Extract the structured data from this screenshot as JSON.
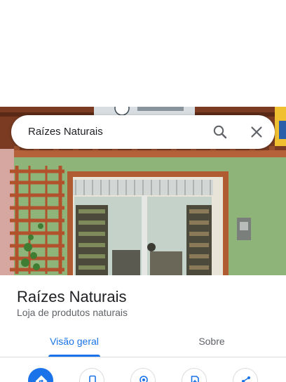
{
  "search": {
    "query": "Raízes Naturais"
  },
  "place": {
    "name": "Raízes Naturais",
    "category": "Loja de produtos naturais"
  },
  "tabs": [
    {
      "label": "Visão geral",
      "active": true
    },
    {
      "label": "Sobre",
      "active": false
    }
  ],
  "actions": [
    {
      "icon": "directions-icon"
    },
    {
      "icon": "phone-icon"
    },
    {
      "icon": "location-pin-icon"
    },
    {
      "icon": "save-icon"
    },
    {
      "icon": "share-icon"
    }
  ],
  "colors": {
    "accent": "#1a73e8",
    "title_text": "#202124",
    "secondary_text": "#5f6368",
    "divider": "#dadce0"
  }
}
